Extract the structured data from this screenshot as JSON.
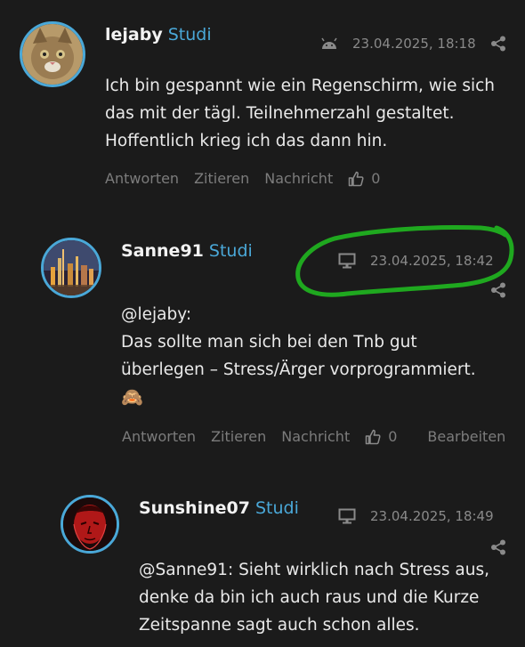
{
  "posts": [
    {
      "username": "lejaby",
      "role": "Studi",
      "timestamp": "23.04.2025, 18:18",
      "device_icon": "android-icon",
      "lines": [
        "Ich bin gespannt wie ein Regenschirm, wie sich",
        "das mit der tägl. Teilnehmerzahl gestaltet.",
        "Hoffentlich krieg ich das dann hin."
      ],
      "actions": {
        "reply": "Antworten",
        "quote": "Zitieren",
        "message": "Nachricht",
        "like_count": "0"
      }
    },
    {
      "username": "Sanne91",
      "role": "Studi",
      "timestamp": "23.04.2025, 18:42",
      "device_icon": "desktop-icon",
      "lines": [
        "@lejaby:",
        "Das sollte man sich bei den Tnb gut",
        "überlegen – Stress/Ärger vorprogrammiert."
      ],
      "emoji": "🙈",
      "actions": {
        "reply": "Antworten",
        "quote": "Zitieren",
        "message": "Nachricht",
        "like_count": "0",
        "edit": "Bearbeiten"
      }
    },
    {
      "username": "Sunshine07",
      "role": "Studi",
      "timestamp": "23.04.2025, 18:49",
      "device_icon": "desktop-icon",
      "lines": [
        "@Sanne91: Sieht wirklich nach Stress aus,",
        "denke da bin ich auch raus und die Kurze",
        "Zeitspanne sagt auch schon alles."
      ]
    }
  ],
  "colors": {
    "accent": "#4aa8d8",
    "highlight": "#1fa81f",
    "background": "#1b1b1b"
  }
}
